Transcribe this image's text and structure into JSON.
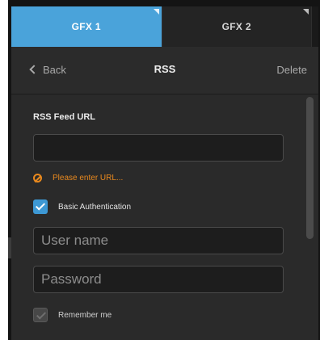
{
  "tabs": [
    {
      "label": "GFX 1",
      "active": true
    },
    {
      "label": "GFX 2",
      "active": false
    }
  ],
  "header": {
    "back_label": "Back",
    "title": "RSS",
    "delete_label": "Delete"
  },
  "form": {
    "feed_url_label": "RSS Feed URL",
    "feed_url_value": "",
    "warning_text": "Please enter URL...",
    "basic_auth_label": "Basic Authentication",
    "basic_auth_checked": true,
    "username_placeholder": "User name",
    "password_placeholder": "Password",
    "remember_label": "Remember me",
    "remember_checked": false
  },
  "colors": {
    "accent": "#4aa3da",
    "warning": "#e9891e",
    "panel": "#2a2a2a"
  },
  "icons": [
    "back-chevron-icon",
    "warning-icon",
    "checkmark-icon"
  ]
}
